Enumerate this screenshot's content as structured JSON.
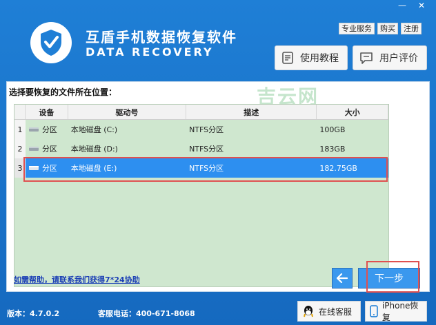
{
  "window": {
    "min_label": "—",
    "close_label": "✕"
  },
  "app": {
    "title": "互盾手机数据恢复软件",
    "subtitle": "DATA RECOVERY"
  },
  "top_links": [
    "专业服务",
    "购买",
    "注册"
  ],
  "buttons": {
    "tutorial": "使用教程",
    "review": "用户评价",
    "next": "下一步",
    "service": "在线客服",
    "iphone": "iPhone恢复"
  },
  "panel": {
    "label": "选择要恢复的文件所在位置：",
    "watermark": "吉云网"
  },
  "table": {
    "headers": [
      "设备",
      "驱动号",
      "描述",
      "大小"
    ],
    "rows": [
      {
        "index": "1",
        "device": "分区",
        "drive": "本地磁盘 (C:)",
        "desc": "NTFS分区",
        "size": "100GB"
      },
      {
        "index": "2",
        "device": "分区",
        "drive": "本地磁盘 (D:)",
        "desc": "NTFS分区",
        "size": "183GB"
      },
      {
        "index": "3",
        "device": "分区",
        "drive": "本地磁盘 (E:)",
        "desc": "NTFS分区",
        "size": "182.75GB"
      }
    ],
    "selected_index": 2
  },
  "help_link": "如需帮助，请联系我们获得7*24协助",
  "footer": {
    "version": "版本：4.7.0.2",
    "phone": "客服电话：400-671-8068"
  },
  "colors": {
    "brand": "#1f7fd6",
    "grid_bg": "#cfe7cf",
    "selection": "#2d8ff0",
    "highlight": "#e05050"
  }
}
